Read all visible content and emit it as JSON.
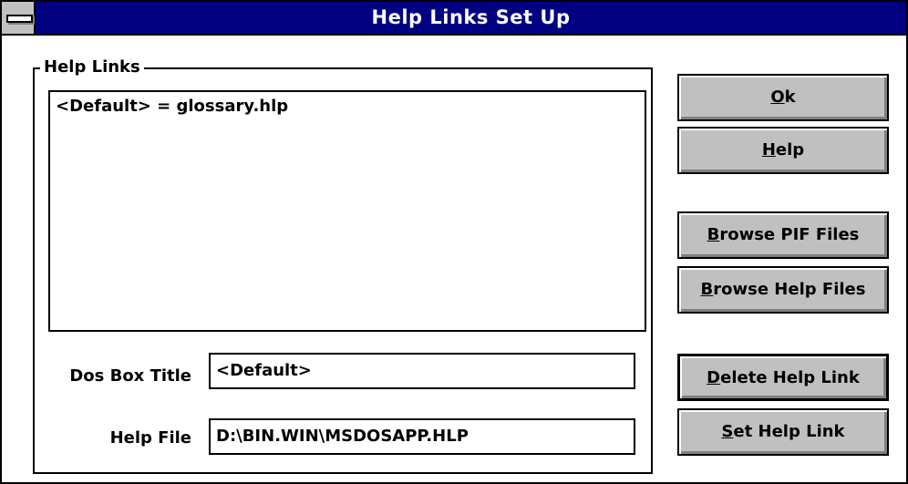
{
  "window": {
    "title": "Help Links Set Up"
  },
  "help_links": {
    "group_label": "Help Links",
    "items": [
      "<Default> = glossary.hlp"
    ]
  },
  "dos_box_title": {
    "label": "Dos Box Title",
    "value": "<Default>"
  },
  "help_file": {
    "label": "Help File",
    "value": "D:\\BIN.WIN\\MSDOSAPP.HLP"
  },
  "buttons": {
    "ok": {
      "mnemonic": "O",
      "rest": "k"
    },
    "help": {
      "mnemonic": "H",
      "rest": "elp"
    },
    "browse_pif": {
      "mnemonic": "B",
      "rest": "rowse PIF Files"
    },
    "browse_help": {
      "mnemonic": "B",
      "rest": "rowse Help Files"
    },
    "delete_link": {
      "mnemonic": "D",
      "rest": "elete Help Link"
    },
    "set_link": {
      "mnemonic": "S",
      "rest": "et Help Link"
    }
  },
  "colors": {
    "titlebar": "#000080",
    "button_face": "#c0c0c0",
    "window_bg": "#ffffff"
  }
}
